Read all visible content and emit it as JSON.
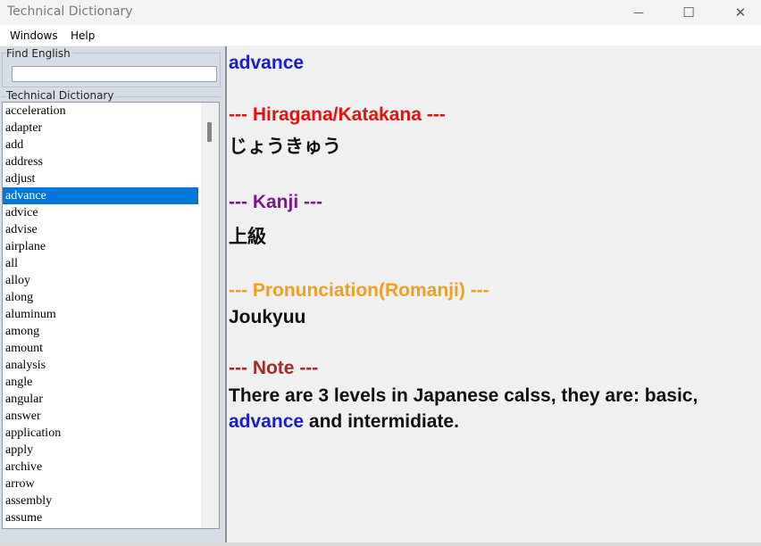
{
  "window": {
    "title": "Technical Dictionary",
    "minimize_glyph": "—",
    "maximize_glyph": "☐",
    "close_glyph": "✕"
  },
  "menu": {
    "items": [
      {
        "label": "Windows"
      },
      {
        "label": "Help"
      }
    ]
  },
  "search": {
    "group_label": "Find English",
    "value": ""
  },
  "list": {
    "group_label": "Technical Dictionary",
    "selected": "advance",
    "items": [
      "acceleration",
      "adapter",
      "add",
      "address",
      "adjust",
      "advance",
      "advice",
      "advise",
      "airplane",
      "all",
      "alloy",
      "along",
      "aluminum",
      "among",
      "amount",
      "analysis",
      "angle",
      "angular",
      "answer",
      "application",
      "apply",
      "archive",
      "arrow",
      "assembly",
      "assume"
    ]
  },
  "entry": {
    "headword": "advance",
    "hiragana_heading": "--- Hiragana/Katakana ---",
    "hiragana": "じょうきゅう",
    "kanji_heading": "--- Kanji ---",
    "kanji": "上級",
    "romanji_heading": "--- Pronunciation(Romanji) ---",
    "romanji": "Joukyuu",
    "note_heading": "--- Note ---",
    "note_before": "There are 3 levels in Japanese calss, they are: basic, ",
    "note_highlight": "advance",
    "note_after": " and intermidiate."
  },
  "colors": {
    "headword": "#1a1add",
    "hiragana_heading": "#e81010",
    "kanji_heading": "#7a1a8a",
    "romanji_heading": "#f0a020",
    "note_heading": "#a52a2a",
    "selection": "#0078d7"
  }
}
